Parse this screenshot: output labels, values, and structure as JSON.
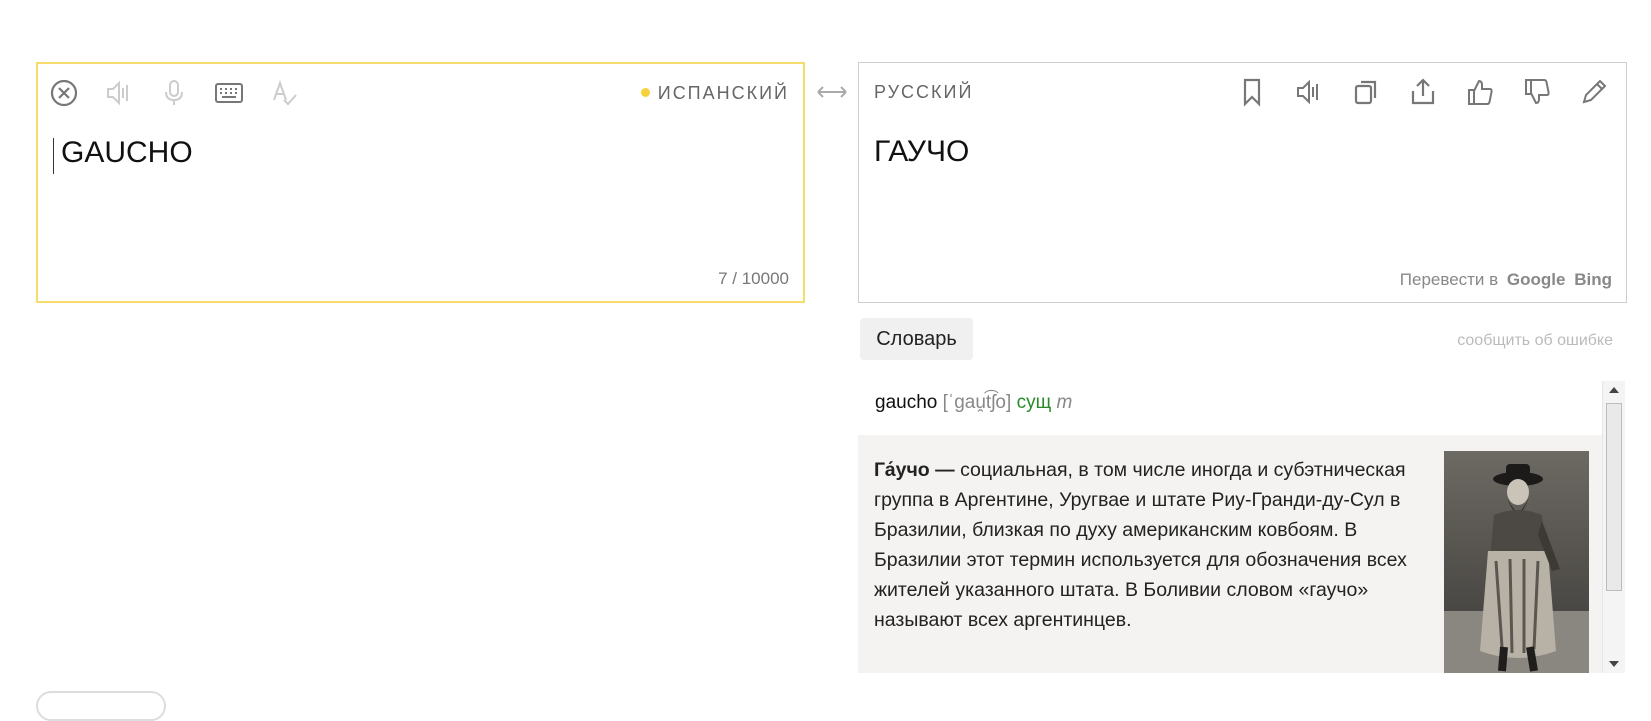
{
  "source": {
    "language": "ИСПАНСКИЙ",
    "text": "GAUCHO",
    "counter": "7 / 10000",
    "icons": [
      "clear-icon",
      "speaker-icon",
      "microphone-icon",
      "keyboard-icon",
      "spellcheck-icon"
    ]
  },
  "target": {
    "language": "РУССКИЙ",
    "text": "ГАУЧО",
    "translate_in": "Перевести в",
    "google": "Google",
    "bing": "Bing",
    "icons": [
      "bookmark-icon",
      "speaker-icon",
      "copy-icon",
      "share-icon",
      "thumbs-up-icon",
      "thumbs-down-icon",
      "edit-icon"
    ]
  },
  "dictionary": {
    "tab_label": "Словарь",
    "report_error": "сообщить об ошибке",
    "word": "gaucho",
    "transcription": "[ˈgau̯t͡ʃo]",
    "part_of_speech": "сущ",
    "gender": "m"
  },
  "wiki": {
    "term": "Га́учо",
    "dash": " — ",
    "text": "социальная, в том числе иногда и субэтническая группа в Аргентине, Уругвае и штате Риу-Гранди-ду-Сул в Бразилии, близкая по духу американским ковбоям. В Бразилии этот термин используется для обозначения всех жителей указанного штата. В Боливии словом «гаучо» называют всех аргентинцев."
  },
  "colors": {
    "accent": "#f6dd6b",
    "icon_gray": "#888888",
    "pos_green": "#2a8a2a"
  }
}
